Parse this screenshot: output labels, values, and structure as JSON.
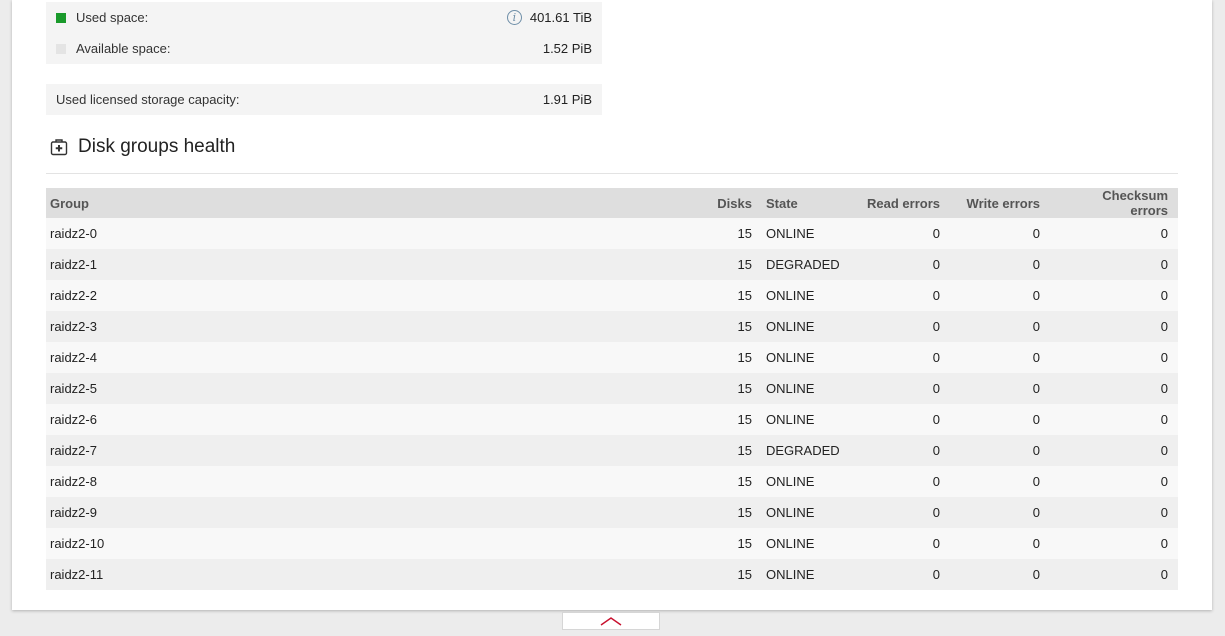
{
  "space": {
    "used_label": "Used space:",
    "used_value": "401.61 TiB",
    "used_color": "#1a9a2b",
    "available_label": "Available space:",
    "available_value": "1.52 PiB",
    "available_color": "#e4e4e4",
    "licensed_label": "Used licensed storage capacity:",
    "licensed_value": "1.91 PiB"
  },
  "health": {
    "title": "Disk groups health",
    "columns": {
      "group": "Group",
      "disks": "Disks",
      "state": "State",
      "read": "Read errors",
      "write": "Write errors",
      "checksum": "Checksum errors"
    },
    "rows": [
      {
        "group": "raidz2-0",
        "disks": "15",
        "state": "ONLINE",
        "read": "0",
        "write": "0",
        "checksum": "0"
      },
      {
        "group": "raidz2-1",
        "disks": "15",
        "state": "DEGRADED",
        "read": "0",
        "write": "0",
        "checksum": "0"
      },
      {
        "group": "raidz2-2",
        "disks": "15",
        "state": "ONLINE",
        "read": "0",
        "write": "0",
        "checksum": "0"
      },
      {
        "group": "raidz2-3",
        "disks": "15",
        "state": "ONLINE",
        "read": "0",
        "write": "0",
        "checksum": "0"
      },
      {
        "group": "raidz2-4",
        "disks": "15",
        "state": "ONLINE",
        "read": "0",
        "write": "0",
        "checksum": "0"
      },
      {
        "group": "raidz2-5",
        "disks": "15",
        "state": "ONLINE",
        "read": "0",
        "write": "0",
        "checksum": "0"
      },
      {
        "group": "raidz2-6",
        "disks": "15",
        "state": "ONLINE",
        "read": "0",
        "write": "0",
        "checksum": "0"
      },
      {
        "group": "raidz2-7",
        "disks": "15",
        "state": "DEGRADED",
        "read": "0",
        "write": "0",
        "checksum": "0"
      },
      {
        "group": "raidz2-8",
        "disks": "15",
        "state": "ONLINE",
        "read": "0",
        "write": "0",
        "checksum": "0"
      },
      {
        "group": "raidz2-9",
        "disks": "15",
        "state": "ONLINE",
        "read": "0",
        "write": "0",
        "checksum": "0"
      },
      {
        "group": "raidz2-10",
        "disks": "15",
        "state": "ONLINE",
        "read": "0",
        "write": "0",
        "checksum": "0"
      },
      {
        "group": "raidz2-11",
        "disks": "15",
        "state": "ONLINE",
        "read": "0",
        "write": "0",
        "checksum": "0"
      }
    ]
  },
  "icons": {
    "info": "info-icon",
    "health": "medical-kit-icon",
    "scroll_top": "chevron-up-icon"
  },
  "accent_color": "#c8102e"
}
